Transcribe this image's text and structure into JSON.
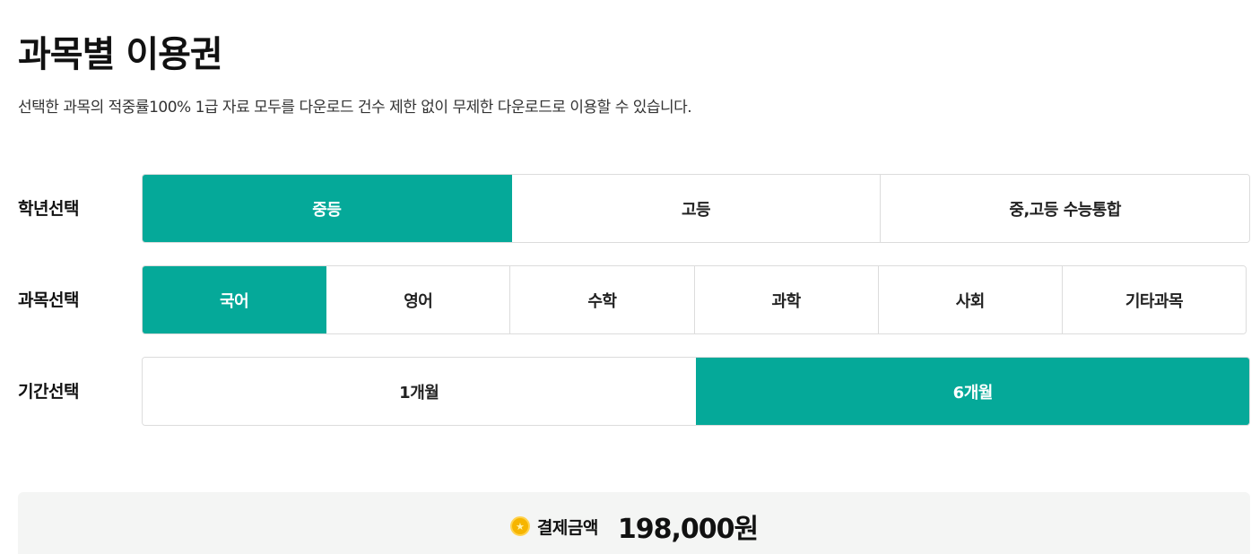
{
  "page": {
    "title": "과목별 이용권",
    "description": "선택한 과목의 적중률100% 1급 자료 모두를 다운로드 건수 제한 없이 무제한 다운로드로 이용할 수 있습니다."
  },
  "grade": {
    "label": "학년선택",
    "options": [
      "중등",
      "고등",
      "중,고등 수능통합"
    ],
    "selected": "중등"
  },
  "subject": {
    "label": "과목선택",
    "options": [
      "국어",
      "영어",
      "수학",
      "과학",
      "사회",
      "기타과목"
    ],
    "selected": "국어"
  },
  "period": {
    "label": "기간선택",
    "options": [
      "1개월",
      "6개월"
    ],
    "selected": "6개월"
  },
  "payment": {
    "icon": "coin-icon",
    "label": "결제금액",
    "amount": "198,000원"
  },
  "colors": {
    "accent": "#05a999",
    "coin": "#f6b500"
  }
}
